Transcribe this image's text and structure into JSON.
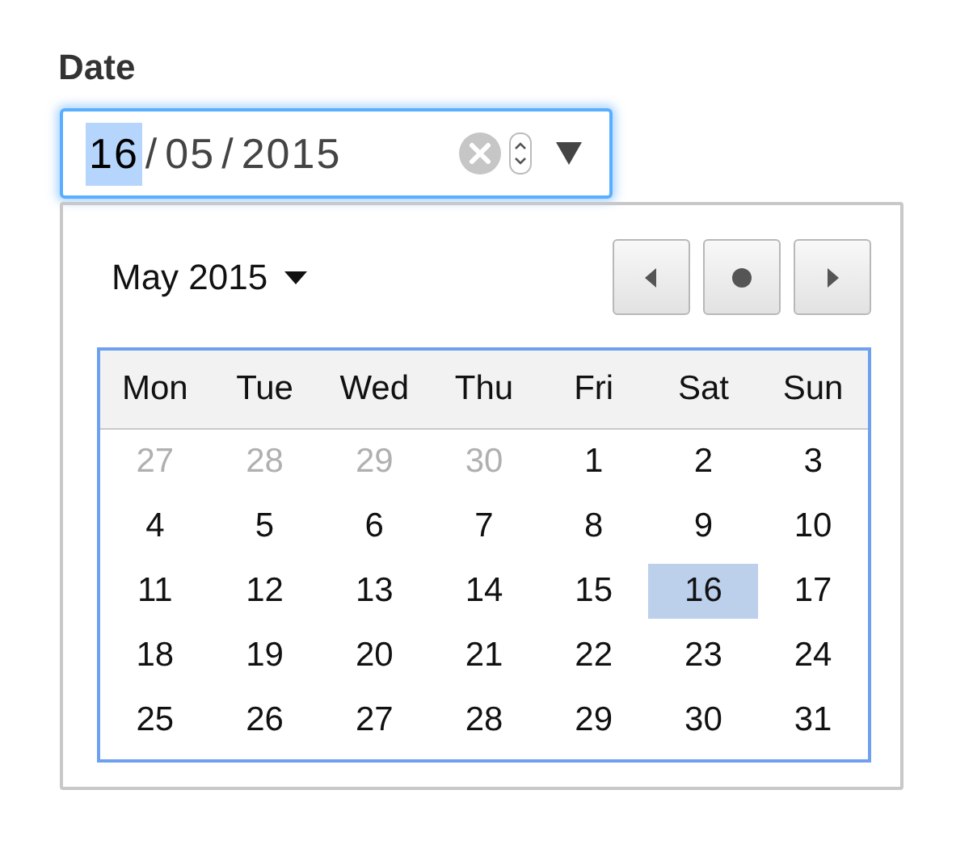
{
  "label": "Date",
  "field": {
    "segments": [
      {
        "text": "16",
        "selected": true
      },
      {
        "text": "/",
        "selected": false
      },
      {
        "text": "05",
        "selected": false
      },
      {
        "text": "/",
        "selected": false
      },
      {
        "text": "2015",
        "selected": false
      }
    ]
  },
  "calendar": {
    "month": "May 2015",
    "weekdays": [
      "Mon",
      "Tue",
      "Wed",
      "Thu",
      "Fri",
      "Sat",
      "Sun"
    ],
    "weeks": [
      [
        {
          "text": "27",
          "outside": true,
          "selected": false
        },
        {
          "text": "28",
          "outside": true,
          "selected": false
        },
        {
          "text": "29",
          "outside": true,
          "selected": false
        },
        {
          "text": "30",
          "outside": true,
          "selected": false
        },
        {
          "text": "1",
          "outside": false,
          "selected": false
        },
        {
          "text": "2",
          "outside": false,
          "selected": false
        },
        {
          "text": "3",
          "outside": false,
          "selected": false
        }
      ],
      [
        {
          "text": "4",
          "outside": false,
          "selected": false
        },
        {
          "text": "5",
          "outside": false,
          "selected": false
        },
        {
          "text": "6",
          "outside": false,
          "selected": false
        },
        {
          "text": "7",
          "outside": false,
          "selected": false
        },
        {
          "text": "8",
          "outside": false,
          "selected": false
        },
        {
          "text": "9",
          "outside": false,
          "selected": false
        },
        {
          "text": "10",
          "outside": false,
          "selected": false
        }
      ],
      [
        {
          "text": "11",
          "outside": false,
          "selected": false
        },
        {
          "text": "12",
          "outside": false,
          "selected": false
        },
        {
          "text": "13",
          "outside": false,
          "selected": false
        },
        {
          "text": "14",
          "outside": false,
          "selected": false
        },
        {
          "text": "15",
          "outside": false,
          "selected": false
        },
        {
          "text": "16",
          "outside": false,
          "selected": true
        },
        {
          "text": "17",
          "outside": false,
          "selected": false
        }
      ],
      [
        {
          "text": "18",
          "outside": false,
          "selected": false
        },
        {
          "text": "19",
          "outside": false,
          "selected": false
        },
        {
          "text": "20",
          "outside": false,
          "selected": false
        },
        {
          "text": "21",
          "outside": false,
          "selected": false
        },
        {
          "text": "22",
          "outside": false,
          "selected": false
        },
        {
          "text": "23",
          "outside": false,
          "selected": false
        },
        {
          "text": "24",
          "outside": false,
          "selected": false
        }
      ],
      [
        {
          "text": "25",
          "outside": false,
          "selected": false
        },
        {
          "text": "26",
          "outside": false,
          "selected": false
        },
        {
          "text": "27",
          "outside": false,
          "selected": false
        },
        {
          "text": "28",
          "outside": false,
          "selected": false
        },
        {
          "text": "29",
          "outside": false,
          "selected": false
        },
        {
          "text": "30",
          "outside": false,
          "selected": false
        },
        {
          "text": "31",
          "outside": false,
          "selected": false
        }
      ]
    ]
  }
}
